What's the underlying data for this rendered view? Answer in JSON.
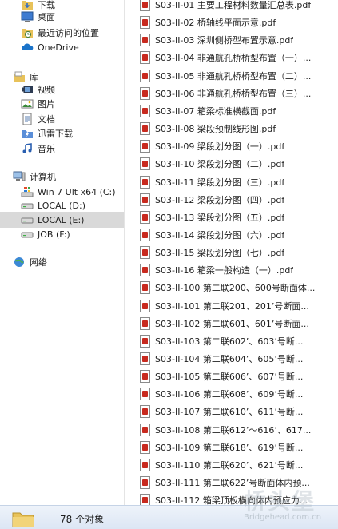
{
  "nav": {
    "items": [
      {
        "label": "下载",
        "icon": "download-folder-icon",
        "indent": 1
      },
      {
        "label": "桌面",
        "icon": "desktop-icon",
        "indent": 1
      },
      {
        "label": "最近访问的位置",
        "icon": "recent-places-icon",
        "indent": 1
      },
      {
        "label": "OneDrive",
        "icon": "onedrive-cloud-icon",
        "indent": 1
      },
      {
        "label": "库",
        "icon": "libraries-icon",
        "indent": 0
      },
      {
        "label": "视频",
        "icon": "videos-icon",
        "indent": 1
      },
      {
        "label": "图片",
        "icon": "pictures-icon",
        "indent": 1
      },
      {
        "label": "文档",
        "icon": "documents-icon",
        "indent": 1
      },
      {
        "label": "迅雷下载",
        "icon": "thunder-download-icon",
        "indent": 1
      },
      {
        "label": "音乐",
        "icon": "music-icon",
        "indent": 1
      },
      {
        "label": "计算机",
        "icon": "computer-icon",
        "indent": 0
      },
      {
        "label": "Win 7 Ult x64 (C:)",
        "icon": "system-drive-icon",
        "indent": 1
      },
      {
        "label": "LOCAL (D:)",
        "icon": "drive-icon",
        "indent": 1
      },
      {
        "label": "LOCAL (E:)",
        "icon": "drive-icon",
        "indent": 1,
        "selected": true
      },
      {
        "label": "JOB (F:)",
        "icon": "drive-icon",
        "indent": 1
      },
      {
        "label": "网络",
        "icon": "network-icon",
        "indent": 0
      }
    ]
  },
  "files": [
    "S03-II-01 主要工程材料数量汇总表.pdf",
    "S03-II-02 桥轴线平面示意.pdf",
    "S03-II-03 深圳侧桥型布置示意.pdf",
    "S03-II-04 非通航孔桥桥型布置（一）...",
    "S03-II-05 非通航孔桥桥型布置（二）...",
    "S03-II-06 非通航孔桥桥型布置（三）...",
    "S03-II-07 箱梁标准横截面.pdf",
    "S03-II-08 梁段预制线形图.pdf",
    "S03-II-09 梁段划分图（一）.pdf",
    "S03-II-10 梁段划分图（二）.pdf",
    "S03-II-11 梁段划分图（三）.pdf",
    "S03-II-12 梁段划分图（四）.pdf",
    "S03-II-13 梁段划分图（五）.pdf",
    "S03-II-14 梁段划分图（六）.pdf",
    "S03-II-15 梁段划分图（七）.pdf",
    "S03-II-16 箱梁一般构造（一）.pdf",
    "S03-II-100 第二联200、600号断面体...",
    "S03-II-101 第二联201、201’号断面...",
    "S03-II-102 第二联601、601’号断面...",
    "S03-II-103 第二联602’、603’号断...",
    "S03-II-104 第二联604’、605’号断...",
    "S03-II-105 第二联606’、607’号断...",
    "S03-II-106 第二联608’、609’号断...",
    "S03-II-107 第二联610’、611’号断...",
    "S03-II-108 第二联612’～616’、617...",
    "S03-II-109 第二联618’、619’号断...",
    "S03-II-110 第二联620’、621’号断...",
    "S03-II-111 第二联622’号断面体内预...",
    "S03-II-112 箱梁顶板横向体内预应力..."
  ],
  "status": {
    "count_text": "78 个对象"
  },
  "watermark": {
    "cn": "桥头堡",
    "url": "Bridgehead.com.cn"
  },
  "colors": {
    "selected_bg": "#d9d9d9",
    "pdf_red": "#c82a1f",
    "statusbar": "#dce6f4"
  }
}
